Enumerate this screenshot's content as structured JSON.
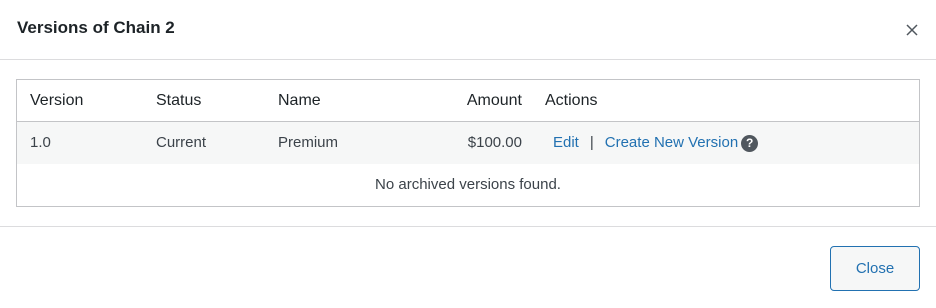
{
  "modal": {
    "title": "Versions of Chain 2",
    "close_icon": "close-icon"
  },
  "table": {
    "headers": {
      "version": "Version",
      "status": "Status",
      "name": "Name",
      "amount": "Amount",
      "actions": "Actions"
    },
    "rows": [
      {
        "version": "1.0",
        "status": "Current",
        "name": "Premium",
        "amount": "$100.00",
        "edit_label": "Edit",
        "separator": "|",
        "create_label": "Create New Version",
        "help_glyph": "?"
      }
    ],
    "empty_message": "No archived versions found."
  },
  "footer": {
    "close_label": "Close"
  },
  "colors": {
    "link": "#2271b1",
    "border": "#c3c4c7",
    "row_alt": "#f6f7f7"
  }
}
